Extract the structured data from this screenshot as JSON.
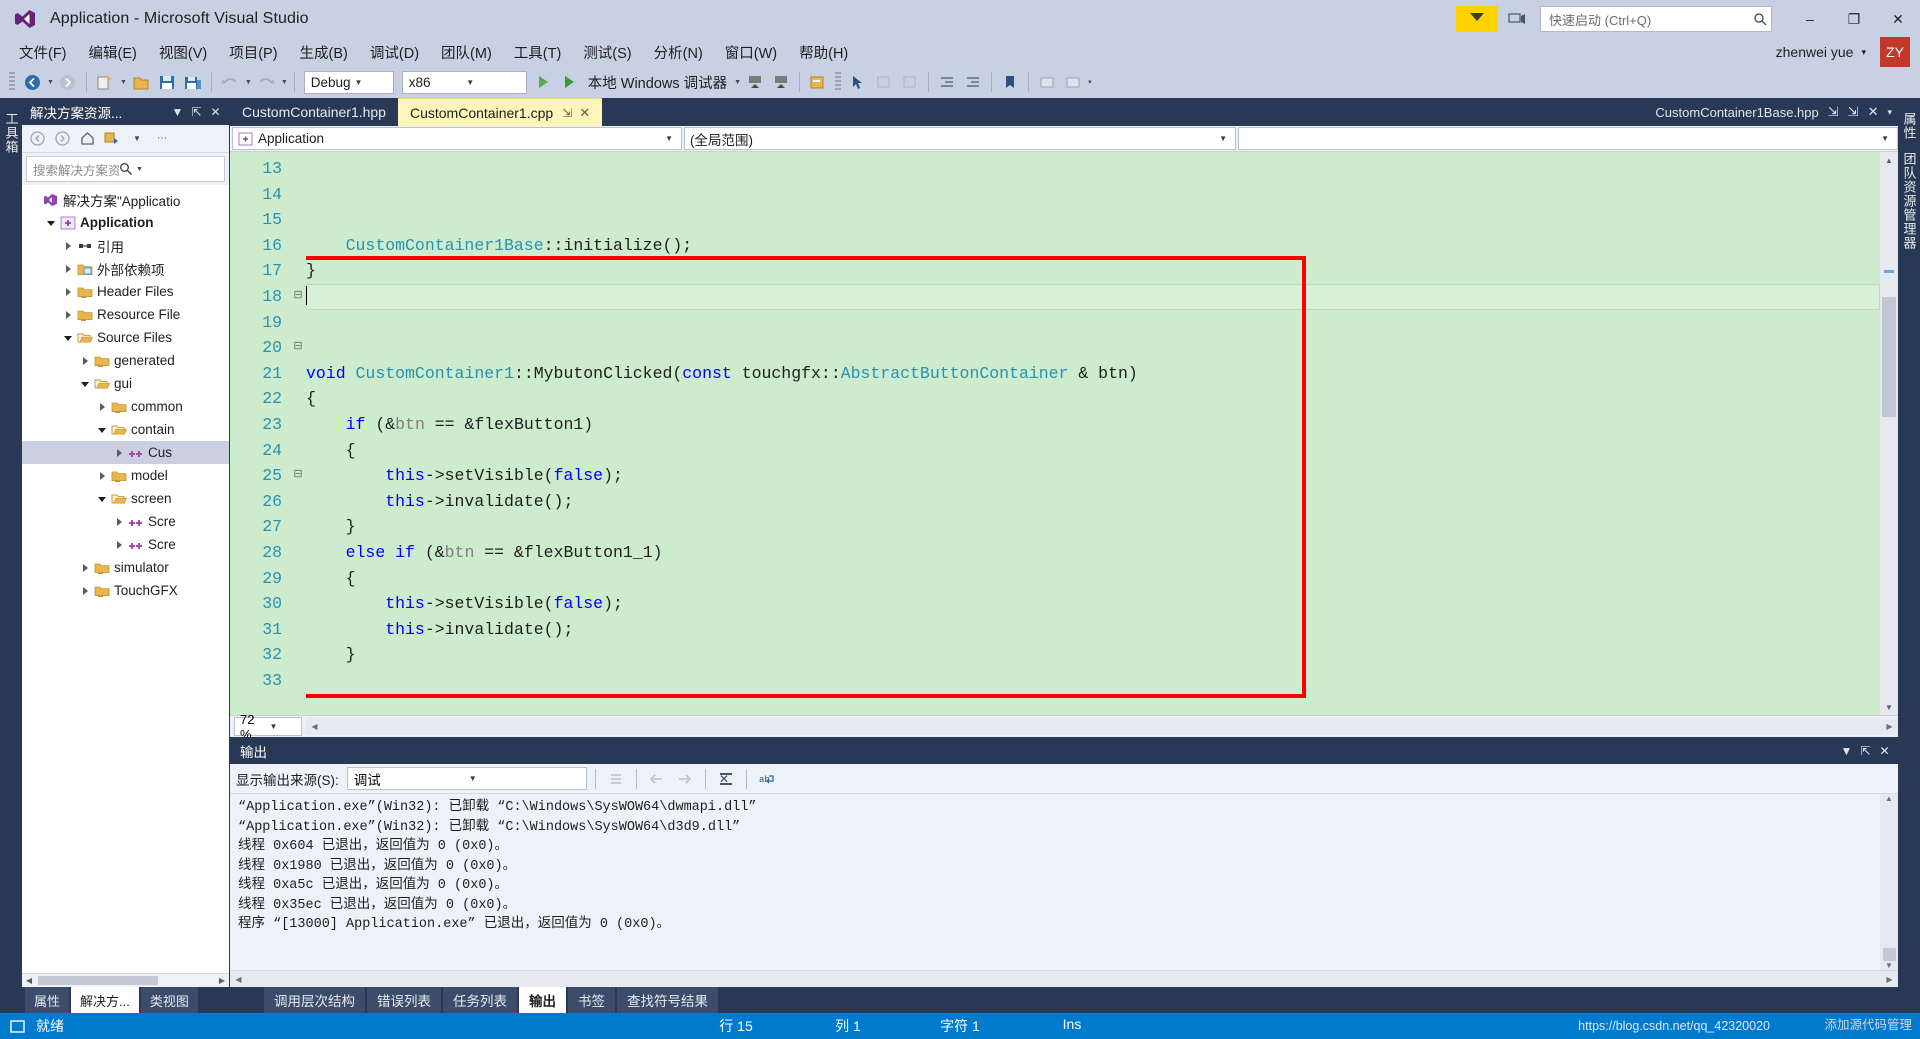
{
  "window": {
    "title": "Application - Microsoft Visual Studio",
    "minimize": "–",
    "maximize": "❐",
    "close": "✕"
  },
  "quick_launch": {
    "placeholder": "快速启动 (Ctrl+Q)",
    "value": ""
  },
  "user": {
    "name": "zhenwei yue",
    "initials": "ZY",
    "caret": "▾"
  },
  "menu": [
    {
      "label": "文件(F)"
    },
    {
      "label": "编辑(E)"
    },
    {
      "label": "视图(V)"
    },
    {
      "label": "项目(P)"
    },
    {
      "label": "生成(B)"
    },
    {
      "label": "调试(D)"
    },
    {
      "label": "团队(M)"
    },
    {
      "label": "工具(T)"
    },
    {
      "label": "测试(S)"
    },
    {
      "label": "分析(N)"
    },
    {
      "label": "窗口(W)"
    },
    {
      "label": "帮助(H)"
    }
  ],
  "toolbar": {
    "config": "Debug",
    "platform": "x86",
    "run_label": "本地 Windows 调试器"
  },
  "solution_explorer": {
    "title": "解决方案资源...",
    "search_placeholder": "搜索解决方案资源管",
    "tree": [
      {
        "label": "解决方案\"Applicatio",
        "indent": 0,
        "state": "none",
        "icon": "solution-icon",
        "bold": false
      },
      {
        "label": "Application",
        "indent": 1,
        "state": "open",
        "icon": "project-icon",
        "bold": true
      },
      {
        "label": "引用",
        "indent": 2,
        "state": "closed",
        "icon": "reference-icon",
        "bold": false
      },
      {
        "label": "外部依赖项",
        "indent": 2,
        "state": "closed",
        "icon": "folder-dep-icon",
        "bold": false
      },
      {
        "label": "Header Files",
        "indent": 2,
        "state": "closed",
        "icon": "folder-icon",
        "bold": false
      },
      {
        "label": "Resource File",
        "indent": 2,
        "state": "closed",
        "icon": "folder-icon",
        "bold": false
      },
      {
        "label": "Source Files",
        "indent": 2,
        "state": "open",
        "icon": "folder-open-icon",
        "bold": false
      },
      {
        "label": "generated",
        "indent": 3,
        "state": "closed",
        "icon": "folder-icon",
        "bold": false
      },
      {
        "label": "gui",
        "indent": 3,
        "state": "open",
        "icon": "folder-open-icon",
        "bold": false
      },
      {
        "label": "common",
        "indent": 4,
        "state": "closed",
        "icon": "folder-icon",
        "bold": false
      },
      {
        "label": "contain",
        "indent": 4,
        "state": "open",
        "icon": "folder-open-icon",
        "bold": false
      },
      {
        "label": "Cus",
        "indent": 5,
        "state": "closed",
        "icon": "cpp-file-icon",
        "bold": false,
        "selected": true
      },
      {
        "label": "model",
        "indent": 4,
        "state": "closed",
        "icon": "folder-icon",
        "bold": false
      },
      {
        "label": "screen",
        "indent": 4,
        "state": "open",
        "icon": "folder-open-icon",
        "bold": false
      },
      {
        "label": "Scre",
        "indent": 5,
        "state": "closed",
        "icon": "cpp-file-icon",
        "bold": false
      },
      {
        "label": "Scre",
        "indent": 5,
        "state": "closed",
        "icon": "cpp-file-icon",
        "bold": false
      },
      {
        "label": "simulator",
        "indent": 3,
        "state": "closed",
        "icon": "folder-icon",
        "bold": false
      },
      {
        "label": "TouchGFX",
        "indent": 3,
        "state": "closed",
        "icon": "folder-icon",
        "bold": false
      }
    ],
    "tabs": [
      {
        "label": "属性",
        "active": false
      },
      {
        "label": "解决方...",
        "active": true
      },
      {
        "label": "类视图",
        "active": false
      }
    ]
  },
  "dock_left_labels": [
    "工具箱"
  ],
  "dock_right_labels": [
    "属性",
    "团队资源管理器"
  ],
  "editor": {
    "tabs": [
      {
        "label": "CustomContainer1.hpp",
        "active": false,
        "pin": "",
        "close": ""
      },
      {
        "label": "CustomContainer1.cpp",
        "active": true,
        "pin": "⇲",
        "close": "✕"
      }
    ],
    "right_tab": {
      "label": "CustomContainer1Base.hpp",
      "pin": "⇲",
      "close": "✕",
      "caret": "▾"
    },
    "nav_scope": "Application",
    "nav_member": "(全局范围)",
    "nav_third": "",
    "zoom": "72 %",
    "lines": [
      {
        "num": 13,
        "indent": 0,
        "tokens": [
          {
            "t": "    ",
            "c": "k-black"
          },
          {
            "t": "CustomContainer1Base",
            "c": "k-type"
          },
          {
            "t": "::initialize();",
            "c": "k-black"
          }
        ]
      },
      {
        "num": 14,
        "indent": 0,
        "tokens": [
          {
            "t": "}",
            "c": "k-black"
          }
        ]
      },
      {
        "num": 15,
        "indent": 0,
        "current": true,
        "tokens": []
      },
      {
        "num": 16,
        "indent": 0,
        "tokens": []
      },
      {
        "num": 17,
        "indent": 0,
        "tokens": []
      },
      {
        "num": 18,
        "fold": "⊟",
        "tokens": [
          {
            "t": "void",
            "c": "k-blue"
          },
          {
            "t": " ",
            "c": "k-black"
          },
          {
            "t": "CustomContainer1",
            "c": "k-type"
          },
          {
            "t": "::MybutonClicked(",
            "c": "k-black"
          },
          {
            "t": "const",
            "c": "k-blue"
          },
          {
            "t": " touchgfx::",
            "c": "k-black"
          },
          {
            "t": "AbstractButtonContainer",
            "c": "k-type"
          },
          {
            "t": " & btn)",
            "c": "k-black"
          }
        ]
      },
      {
        "num": 19,
        "tokens": [
          {
            "t": "{",
            "c": "k-black"
          }
        ]
      },
      {
        "num": 20,
        "fold": "⊟",
        "tokens": [
          {
            "t": "    ",
            "c": "k-black"
          },
          {
            "t": "if",
            "c": "k-blue"
          },
          {
            "t": " (&",
            "c": "k-black"
          },
          {
            "t": "btn",
            "c": "k-gray"
          },
          {
            "t": " == &flexButton1)",
            "c": "k-black"
          }
        ]
      },
      {
        "num": 21,
        "tokens": [
          {
            "t": "    {",
            "c": "k-black"
          }
        ]
      },
      {
        "num": 22,
        "tokens": [
          {
            "t": "        ",
            "c": "k-black"
          },
          {
            "t": "this",
            "c": "k-blue"
          },
          {
            "t": "->setVisible(",
            "c": "k-black"
          },
          {
            "t": "false",
            "c": "k-blue"
          },
          {
            "t": ");",
            "c": "k-black"
          }
        ]
      },
      {
        "num": 23,
        "tokens": [
          {
            "t": "        ",
            "c": "k-black"
          },
          {
            "t": "this",
            "c": "k-blue"
          },
          {
            "t": "->invalidate();",
            "c": "k-black"
          }
        ]
      },
      {
        "num": 24,
        "tokens": [
          {
            "t": "    }",
            "c": "k-black"
          }
        ]
      },
      {
        "num": 25,
        "fold": "⊟",
        "tokens": [
          {
            "t": "    ",
            "c": "k-black"
          },
          {
            "t": "else",
            "c": "k-blue"
          },
          {
            "t": " ",
            "c": "k-black"
          },
          {
            "t": "if",
            "c": "k-blue"
          },
          {
            "t": " (&",
            "c": "k-black"
          },
          {
            "t": "btn",
            "c": "k-gray"
          },
          {
            "t": " == &flexButton1_1)",
            "c": "k-black"
          }
        ]
      },
      {
        "num": 26,
        "tokens": [
          {
            "t": "    {",
            "c": "k-black"
          }
        ]
      },
      {
        "num": 27,
        "tokens": [
          {
            "t": "        ",
            "c": "k-black"
          },
          {
            "t": "this",
            "c": "k-blue"
          },
          {
            "t": "->setVisible(",
            "c": "k-black"
          },
          {
            "t": "false",
            "c": "k-blue"
          },
          {
            "t": ");",
            "c": "k-black"
          }
        ]
      },
      {
        "num": 28,
        "tokens": [
          {
            "t": "        ",
            "c": "k-black"
          },
          {
            "t": "this",
            "c": "k-blue"
          },
          {
            "t": "->invalidate();",
            "c": "k-black"
          }
        ]
      },
      {
        "num": 29,
        "tokens": [
          {
            "t": "    }",
            "c": "k-black"
          }
        ]
      },
      {
        "num": 30,
        "tokens": []
      },
      {
        "num": 31,
        "tokens": []
      },
      {
        "num": 32,
        "tokens": [
          {
            "t": "}",
            "c": "k-black"
          }
        ]
      },
      {
        "num": 33,
        "tokens": []
      }
    ],
    "highlight_color": "#ff0000"
  },
  "output": {
    "title": "输出",
    "source_label": "显示输出来源(S):",
    "source_value": "调试",
    "lines": [
      "“Application.exe”(Win32): 已卸载 “C:\\Windows\\SysWOW64\\dwmapi.dll”",
      "“Application.exe”(Win32): 已卸载 “C:\\Windows\\SysWOW64\\d3d9.dll”",
      "线程 0x604 已退出，返回值为 0 (0x0)。",
      "线程 0x1980 已退出，返回值为 0 (0x0)。",
      "线程 0xa5c 已退出，返回值为 0 (0x0)。",
      "线程 0x35ec 已退出，返回值为 0 (0x0)。",
      "程序 “[13000] Application.exe” 已退出，返回值为 0 (0x0)。"
    ]
  },
  "bottom_tabs": [
    {
      "label": "调用层次结构",
      "active": false
    },
    {
      "label": "错误列表",
      "active": false
    },
    {
      "label": "任务列表",
      "active": false
    },
    {
      "label": "输出",
      "active": true
    },
    {
      "label": "书签",
      "active": false
    },
    {
      "label": "查找符号结果",
      "active": false
    }
  ],
  "statusbar": {
    "ready": "就绪",
    "line": "行 15",
    "column": "列 1",
    "char": "字符 1",
    "insert": "Ins",
    "accent": "#007acc"
  },
  "watermark": {
    "url": "https://blog.csdn.net/qq_42320020",
    "label": "添加源代码管理"
  }
}
